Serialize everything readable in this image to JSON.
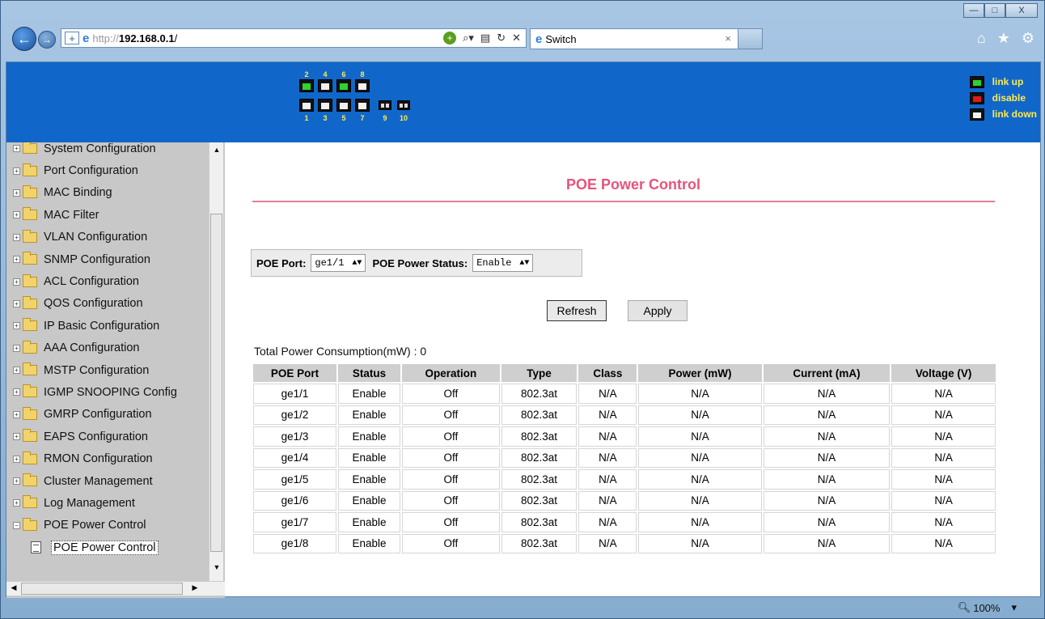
{
  "browser": {
    "url_protocol": "http://",
    "url_host": "192.168.0.1",
    "url_rest": "/",
    "tab_title": "Switch",
    "tab_close": "×",
    "zoom": "100%",
    "zoom_arrow": "▾",
    "window_min": "—",
    "window_max": "□",
    "window_close": "X"
  },
  "banner": {
    "top_port_numbers": [
      "2",
      "4",
      "6",
      "8"
    ],
    "bottom_port_numbers": [
      "1",
      "3",
      "5",
      "7",
      "9",
      "10"
    ],
    "legend": [
      {
        "label": "link up",
        "state": "up",
        "color": "#2fd22f"
      },
      {
        "label": "disable",
        "state": "disabled",
        "color": "#e01a1a"
      },
      {
        "label": "link down",
        "state": "down",
        "color": "#f0f0f0"
      }
    ],
    "port_states": {
      "2": "up",
      "4": "down",
      "6": "up",
      "8": "down",
      "1": "down",
      "3": "down",
      "5": "down",
      "7": "down"
    },
    "background_color": "#1167c9"
  },
  "sidebar": {
    "items": [
      {
        "label": "System Configuration",
        "expander": "+"
      },
      {
        "label": "Port Configuration",
        "expander": "+"
      },
      {
        "label": "MAC Binding",
        "expander": "+"
      },
      {
        "label": "MAC Filter",
        "expander": "+"
      },
      {
        "label": "VLAN Configuration",
        "expander": "+"
      },
      {
        "label": "SNMP Configuration",
        "expander": "+"
      },
      {
        "label": "ACL Configuration",
        "expander": "+"
      },
      {
        "label": "QOS Configuration",
        "expander": "+"
      },
      {
        "label": "IP Basic Configuration",
        "expander": "+"
      },
      {
        "label": "AAA Configuration",
        "expander": "+"
      },
      {
        "label": "MSTP Configuration",
        "expander": "+"
      },
      {
        "label": "IGMP SNOOPING Config",
        "expander": "+"
      },
      {
        "label": "GMRP Configuration",
        "expander": "+"
      },
      {
        "label": "EAPS Configuration",
        "expander": "+"
      },
      {
        "label": "RMON Configuration",
        "expander": "+"
      },
      {
        "label": "Cluster Management",
        "expander": "+"
      },
      {
        "label": "Log Management",
        "expander": "+"
      },
      {
        "label": "POE Power Control",
        "expander": "−"
      }
    ],
    "child": {
      "label": "POE Power Control"
    }
  },
  "main": {
    "title": "POE Power Control",
    "form": {
      "port_label": "POE Port:",
      "port_value": "ge1/1",
      "status_label": "POE Power Status:",
      "status_value": "Enable"
    },
    "refresh_label": "Refresh",
    "apply_label": "Apply",
    "total": "Total Power Consumption(mW) : 0",
    "table": {
      "headers": [
        "POE Port",
        "Status",
        "Operation",
        "Type",
        "Class",
        "Power (mW)",
        "Current (mA)",
        "Voltage (V)"
      ],
      "rows": [
        [
          "ge1/1",
          "Enable",
          "Off",
          "802.3at",
          "N/A",
          "N/A",
          "N/A",
          "N/A"
        ],
        [
          "ge1/2",
          "Enable",
          "Off",
          "802.3at",
          "N/A",
          "N/A",
          "N/A",
          "N/A"
        ],
        [
          "ge1/3",
          "Enable",
          "Off",
          "802.3at",
          "N/A",
          "N/A",
          "N/A",
          "N/A"
        ],
        [
          "ge1/4",
          "Enable",
          "Off",
          "802.3at",
          "N/A",
          "N/A",
          "N/A",
          "N/A"
        ],
        [
          "ge1/5",
          "Enable",
          "Off",
          "802.3at",
          "N/A",
          "N/A",
          "N/A",
          "N/A"
        ],
        [
          "ge1/6",
          "Enable",
          "Off",
          "802.3at",
          "N/A",
          "N/A",
          "N/A",
          "N/A"
        ],
        [
          "ge1/7",
          "Enable",
          "Off",
          "802.3at",
          "N/A",
          "N/A",
          "N/A",
          "N/A"
        ],
        [
          "ge1/8",
          "Enable",
          "Off",
          "802.3at",
          "N/A",
          "N/A",
          "N/A",
          "N/A"
        ]
      ]
    }
  },
  "colors": {
    "title": "#e5547a",
    "title_rule": "#e87d95",
    "banner": "#1167c9",
    "legend_text": "#ffea4f"
  }
}
